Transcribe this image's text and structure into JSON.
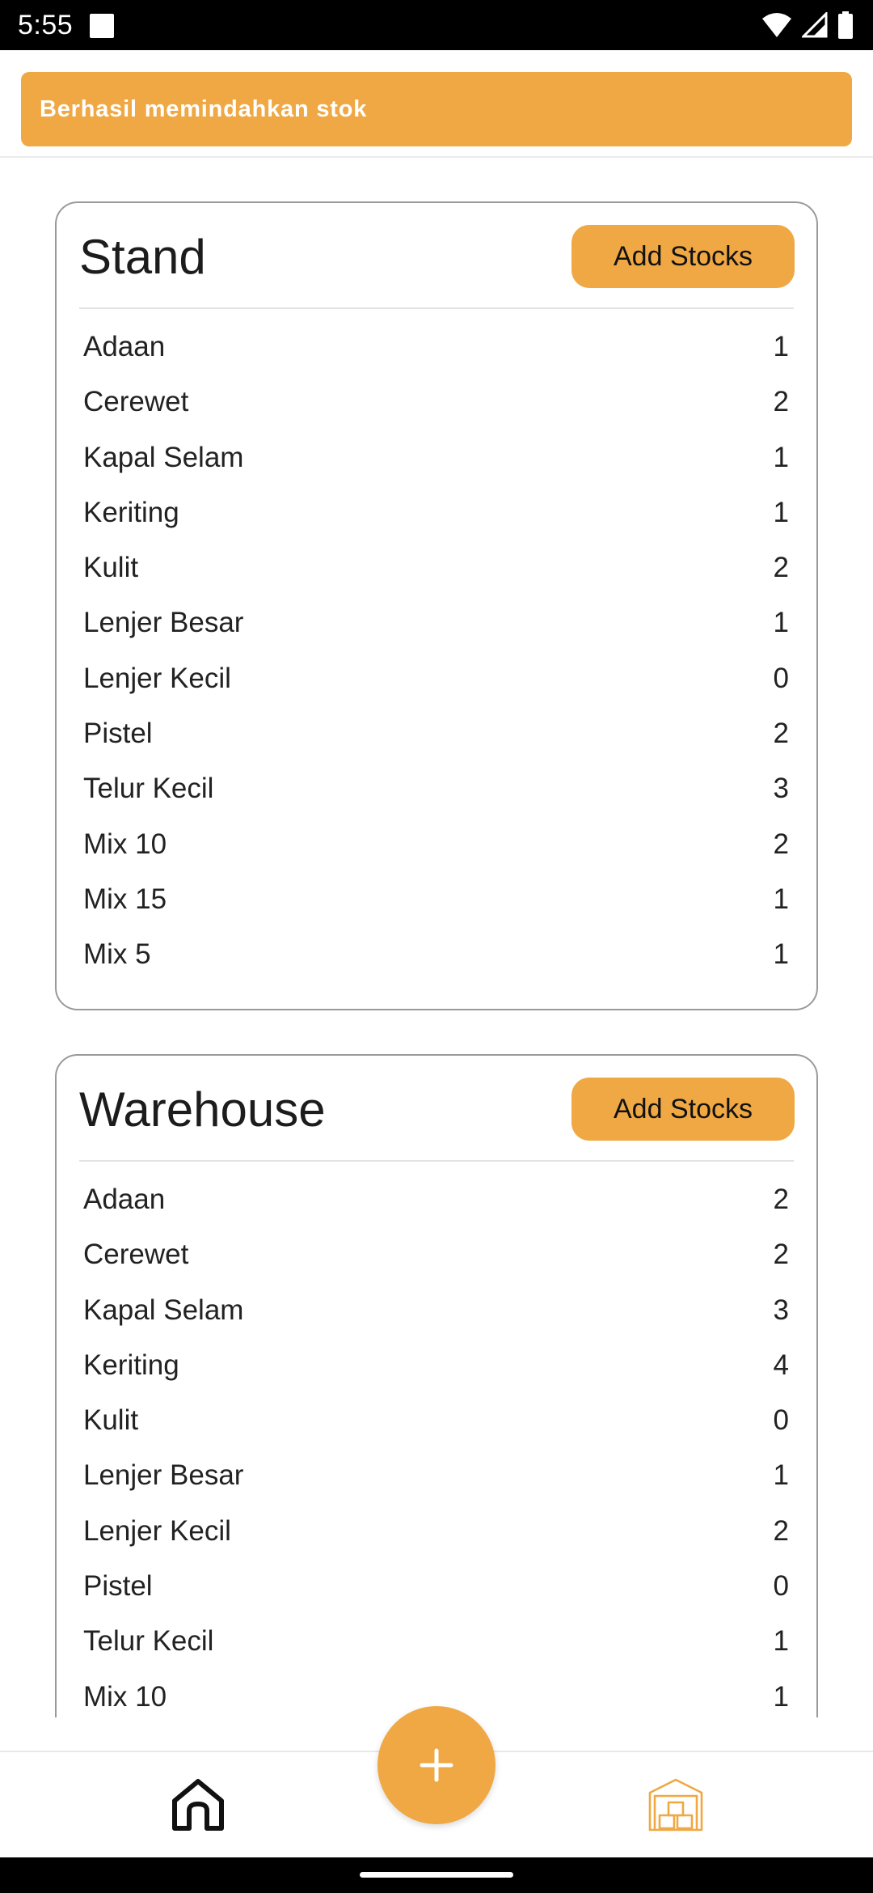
{
  "status_bar": {
    "time": "5:55"
  },
  "snackbar": {
    "message": "Berhasil memindahkan stok"
  },
  "stand": {
    "title": "Stand",
    "add_label": "Add Stocks",
    "items": [
      {
        "name": "Adaan",
        "qty": "1"
      },
      {
        "name": "Cerewet",
        "qty": "2"
      },
      {
        "name": "Kapal Selam",
        "qty": "1"
      },
      {
        "name": "Keriting",
        "qty": "1"
      },
      {
        "name": "Kulit",
        "qty": "2"
      },
      {
        "name": "Lenjer Besar",
        "qty": "1"
      },
      {
        "name": "Lenjer Kecil",
        "qty": "0"
      },
      {
        "name": "Pistel",
        "qty": "2"
      },
      {
        "name": "Telur Kecil",
        "qty": "3"
      },
      {
        "name": "Mix 10",
        "qty": "2"
      },
      {
        "name": "Mix 15",
        "qty": "1"
      },
      {
        "name": "Mix 5",
        "qty": "1"
      }
    ]
  },
  "warehouse": {
    "title": "Warehouse",
    "add_label": "Add Stocks",
    "items": [
      {
        "name": "Adaan",
        "qty": "2"
      },
      {
        "name": "Cerewet",
        "qty": "2"
      },
      {
        "name": "Kapal Selam",
        "qty": "3"
      },
      {
        "name": "Keriting",
        "qty": "4"
      },
      {
        "name": "Kulit",
        "qty": "0"
      },
      {
        "name": "Lenjer Besar",
        "qty": "1"
      },
      {
        "name": "Lenjer Kecil",
        "qty": "2"
      },
      {
        "name": "Pistel",
        "qty": "0"
      },
      {
        "name": "Telur Kecil",
        "qty": "1"
      },
      {
        "name": "Mix 10",
        "qty": "1"
      }
    ]
  },
  "bottom_nav": {
    "items": [
      {
        "icon": "home-icon",
        "active": true
      },
      {
        "icon": "warehouse-icon",
        "active": false
      }
    ],
    "fab_icon": "plus-icon"
  },
  "colors": {
    "accent": "#EFA843",
    "card_border": "#9a9a9a",
    "text": "#222222"
  }
}
